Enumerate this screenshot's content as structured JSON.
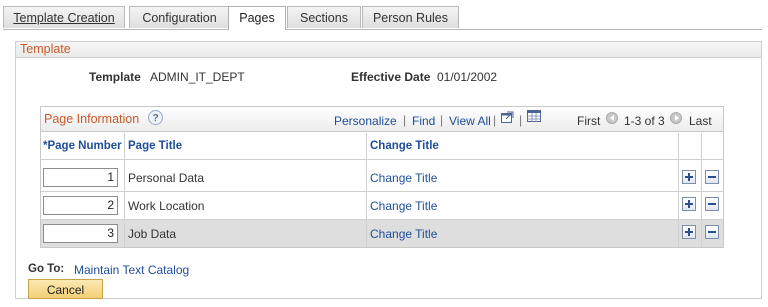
{
  "tabs": [
    {
      "label": "Template Creation"
    },
    {
      "label": "Configuration"
    },
    {
      "label": "Pages"
    },
    {
      "label": "Sections"
    },
    {
      "label": "Person Rules"
    }
  ],
  "template_section": {
    "title": "Template",
    "template_label": "Template",
    "template_value": "ADMIN_IT_DEPT",
    "effective_date_label": "Effective Date",
    "effective_date_value": "01/01/2002"
  },
  "grid": {
    "title": "Page Information",
    "help_glyph": "?",
    "personalize": "Personalize",
    "find": "Find",
    "view_all": "View All",
    "first": "First",
    "range": "1-3 of 3",
    "last": "Last",
    "columns": {
      "page_number": "*Page Number",
      "page_title": "Page Title",
      "change_title": "Change Title"
    },
    "rows": [
      {
        "number": "1",
        "title": "Personal Data",
        "link": "Change Title"
      },
      {
        "number": "2",
        "title": "Work Location",
        "link": "Change Title"
      },
      {
        "number": "3",
        "title": "Job Data",
        "link": "Change Title"
      }
    ]
  },
  "goto": {
    "label": "Go To:",
    "link": "Maintain Text Catalog"
  },
  "cancel_label": "Cancel"
}
